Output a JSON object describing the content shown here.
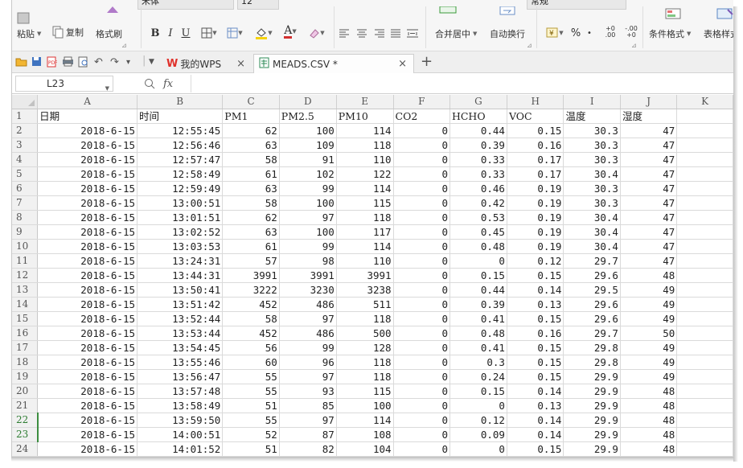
{
  "ribbon": {
    "top_font": "宋体",
    "top_size": "12",
    "top_numfmt": "常规",
    "paste": "粘贴",
    "copy": "复制",
    "format_painter": "格式刷",
    "bold": "B",
    "italic": "I",
    "underline": "U",
    "merge_center": "合并居中",
    "wrap_text": "自动换行",
    "percent": "%",
    "thousands": "•",
    "inc_decimal": "+0 .00",
    "dec_decimal": "-.00 +0",
    "cond_format": "条件格式",
    "table_style": "表格样式"
  },
  "tabs": [
    {
      "label": "我的WPS",
      "close": "×"
    },
    {
      "label": "MEADS.CSV *",
      "close": "×"
    }
  ],
  "new_tab": "+",
  "formula_bar": {
    "name_box": "L23",
    "fx": "fx",
    "formula": ""
  },
  "columns": [
    "A",
    "B",
    "C",
    "D",
    "E",
    "F",
    "G",
    "H",
    "I",
    "J",
    "K"
  ],
  "rows": [
    {
      "n": "1",
      "cells": [
        "日期",
        "时间",
        "PM1",
        "PM2.5",
        "PM10",
        "CO2",
        "HCHO",
        "VOC",
        "温度",
        "湿度",
        ""
      ]
    },
    {
      "n": "2",
      "cells": [
        "2018-6-15",
        "12:55:45",
        "62",
        "100",
        "114",
        "0",
        "0.44",
        "0.15",
        "30.3",
        "47",
        ""
      ]
    },
    {
      "n": "3",
      "cells": [
        "2018-6-15",
        "12:56:46",
        "63",
        "109",
        "118",
        "0",
        "0.39",
        "0.16",
        "30.3",
        "47",
        ""
      ]
    },
    {
      "n": "4",
      "cells": [
        "2018-6-15",
        "12:57:47",
        "58",
        "91",
        "110",
        "0",
        "0.33",
        "0.17",
        "30.3",
        "47",
        ""
      ]
    },
    {
      "n": "5",
      "cells": [
        "2018-6-15",
        "12:58:49",
        "61",
        "102",
        "122",
        "0",
        "0.33",
        "0.17",
        "30.4",
        "47",
        ""
      ]
    },
    {
      "n": "6",
      "cells": [
        "2018-6-15",
        "12:59:49",
        "63",
        "99",
        "114",
        "0",
        "0.46",
        "0.19",
        "30.3",
        "47",
        ""
      ]
    },
    {
      "n": "7",
      "cells": [
        "2018-6-15",
        "13:00:51",
        "58",
        "100",
        "115",
        "0",
        "0.42",
        "0.19",
        "30.3",
        "47",
        ""
      ]
    },
    {
      "n": "8",
      "cells": [
        "2018-6-15",
        "13:01:51",
        "62",
        "97",
        "118",
        "0",
        "0.53",
        "0.19",
        "30.4",
        "47",
        ""
      ]
    },
    {
      "n": "9",
      "cells": [
        "2018-6-15",
        "13:02:52",
        "63",
        "100",
        "117",
        "0",
        "0.45",
        "0.19",
        "30.4",
        "47",
        ""
      ]
    },
    {
      "n": "10",
      "cells": [
        "2018-6-15",
        "13:03:53",
        "61",
        "99",
        "114",
        "0",
        "0.48",
        "0.19",
        "30.4",
        "47",
        ""
      ]
    },
    {
      "n": "11",
      "cells": [
        "2018-6-15",
        "13:24:31",
        "57",
        "98",
        "110",
        "0",
        "0",
        "0.12",
        "29.7",
        "47",
        ""
      ]
    },
    {
      "n": "12",
      "cells": [
        "2018-6-15",
        "13:44:31",
        "3991",
        "3991",
        "3991",
        "0",
        "0.15",
        "0.15",
        "29.6",
        "48",
        ""
      ]
    },
    {
      "n": "13",
      "cells": [
        "2018-6-15",
        "13:50:41",
        "3222",
        "3230",
        "3238",
        "0",
        "0.44",
        "0.14",
        "29.5",
        "49",
        ""
      ]
    },
    {
      "n": "14",
      "cells": [
        "2018-6-15",
        "13:51:42",
        "452",
        "486",
        "511",
        "0",
        "0.39",
        "0.13",
        "29.6",
        "49",
        ""
      ]
    },
    {
      "n": "15",
      "cells": [
        "2018-6-15",
        "13:52:44",
        "58",
        "97",
        "118",
        "0",
        "0.41",
        "0.15",
        "29.6",
        "49",
        ""
      ]
    },
    {
      "n": "16",
      "cells": [
        "2018-6-15",
        "13:53:44",
        "452",
        "486",
        "500",
        "0",
        "0.48",
        "0.16",
        "29.7",
        "50",
        ""
      ]
    },
    {
      "n": "17",
      "cells": [
        "2018-6-15",
        "13:54:45",
        "56",
        "99",
        "128",
        "0",
        "0.41",
        "0.15",
        "29.8",
        "49",
        ""
      ]
    },
    {
      "n": "18",
      "cells": [
        "2018-6-15",
        "13:55:46",
        "60",
        "96",
        "118",
        "0",
        "0.3",
        "0.15",
        "29.8",
        "49",
        ""
      ]
    },
    {
      "n": "19",
      "cells": [
        "2018-6-15",
        "13:56:47",
        "55",
        "97",
        "118",
        "0",
        "0.24",
        "0.15",
        "29.9",
        "49",
        ""
      ]
    },
    {
      "n": "20",
      "cells": [
        "2018-6-15",
        "13:57:48",
        "55",
        "93",
        "115",
        "0",
        "0.15",
        "0.14",
        "29.9",
        "48",
        ""
      ]
    },
    {
      "n": "21",
      "cells": [
        "2018-6-15",
        "13:58:49",
        "51",
        "85",
        "100",
        "0",
        "0",
        "0.13",
        "29.9",
        "48",
        ""
      ]
    },
    {
      "n": "22",
      "cells": [
        "2018-6-15",
        "13:59:50",
        "55",
        "97",
        "114",
        "0",
        "0.12",
        "0.14",
        "29.9",
        "48",
        ""
      ]
    },
    {
      "n": "23",
      "cells": [
        "2018-6-15",
        "14:00:51",
        "52",
        "87",
        "108",
        "0",
        "0.09",
        "0.14",
        "29.9",
        "48",
        ""
      ]
    },
    {
      "n": "24",
      "cells": [
        "2018-6-15",
        "14:01:52",
        "51",
        "82",
        "104",
        "0",
        "0",
        "0.15",
        "29.9",
        "48",
        ""
      ]
    }
  ],
  "selected_rows": [
    "22",
    "23"
  ],
  "colors": {
    "accent_red": "#d32f2f",
    "wps_red": "#e0312b",
    "selection_green": "#3c8d40"
  }
}
